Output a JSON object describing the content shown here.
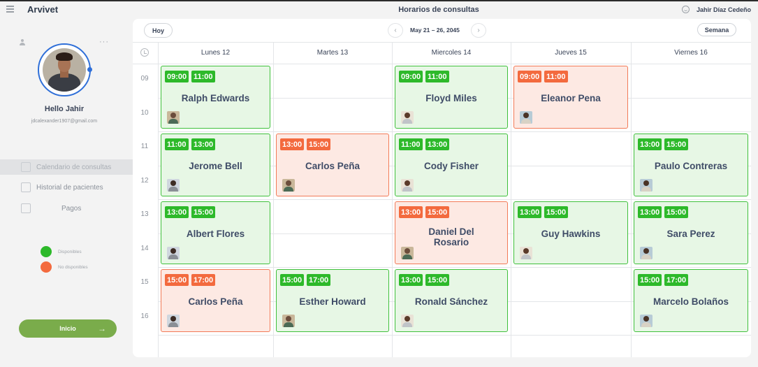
{
  "app": {
    "title": "Arvivet",
    "page_title": "Horarios de consultas",
    "user_name": "Jahir Díaz Cedeño"
  },
  "sidebar": {
    "greeting": "Hello Jahir",
    "email": "jdcalexander1907@gmail.com",
    "items": [
      {
        "label": "Calendario de consultas",
        "icon": "calendar-icon",
        "active": true
      },
      {
        "label": "Historial de pacientes",
        "icon": "contact-card-icon",
        "active": false
      },
      {
        "label": "Pagos",
        "icon": "clipboard-icon",
        "active": false
      }
    ],
    "legend": [
      {
        "label": "Disponibles",
        "color": "#2db92a"
      },
      {
        "label": "No disponibles",
        "color": "#f36a3e"
      }
    ],
    "start_button": "Inicio"
  },
  "calendar": {
    "today_button": "Hoy",
    "date_range": "May 21 – 26, 2045",
    "view_button": "Semana",
    "days": [
      "Lunes 12",
      "Martes 13",
      "Miercoles 14",
      "Jueves 15",
      "Viernes 16"
    ],
    "hours": [
      "09",
      "10",
      "11",
      "12",
      "13",
      "14",
      "15",
      "16"
    ],
    "colors": {
      "available": "#2db92a",
      "unavailable": "#f36a3e"
    },
    "appointments": [
      {
        "day": 0,
        "slot": 0,
        "start": "09:00",
        "end": "11:00",
        "name": "Ralph Edwards",
        "status": "available"
      },
      {
        "day": 2,
        "slot": 0,
        "start": "09:00",
        "end": "11:00",
        "name": "Floyd Miles",
        "status": "available"
      },
      {
        "day": 3,
        "slot": 0,
        "start": "09:00",
        "end": "11:00",
        "name": "Eleanor Pena",
        "status": "unavailable"
      },
      {
        "day": 0,
        "slot": 1,
        "start": "11:00",
        "end": "13:00",
        "name": "Jerome Bell",
        "status": "available"
      },
      {
        "day": 1,
        "slot": 1,
        "start": "13:00",
        "end": "15:00",
        "name": "Carlos Peña",
        "status": "unavailable"
      },
      {
        "day": 2,
        "slot": 1,
        "start": "11:00",
        "end": "13:00",
        "name": "Cody Fisher",
        "status": "available"
      },
      {
        "day": 4,
        "slot": 1,
        "start": "13:00",
        "end": "15:00",
        "name": "Paulo Contreras",
        "status": "available"
      },
      {
        "day": 0,
        "slot": 2,
        "start": "13:00",
        "end": "15:00",
        "name": "Albert Flores",
        "status": "available"
      },
      {
        "day": 2,
        "slot": 2,
        "start": "13:00",
        "end": "15:00",
        "name": "Daniel Del Rosario",
        "status": "unavailable"
      },
      {
        "day": 3,
        "slot": 2,
        "start": "13:00",
        "end": "15:00",
        "name": "Guy Hawkins",
        "status": "available"
      },
      {
        "day": 4,
        "slot": 2,
        "start": "13:00",
        "end": "15:00",
        "name": "Sara Perez",
        "status": "available"
      },
      {
        "day": 0,
        "slot": 3,
        "start": "15:00",
        "end": "17:00",
        "name": "Carlos Peña",
        "status": "unavailable"
      },
      {
        "day": 1,
        "slot": 3,
        "start": "15:00",
        "end": "17:00",
        "name": "Esther Howard",
        "status": "available"
      },
      {
        "day": 2,
        "slot": 3,
        "start": "13:00",
        "end": "15:00",
        "name": "Ronald Sánchez",
        "status": "available"
      },
      {
        "day": 4,
        "slot": 3,
        "start": "15:00",
        "end": "17:00",
        "name": "Marcelo Bolaños",
        "status": "available"
      }
    ]
  }
}
